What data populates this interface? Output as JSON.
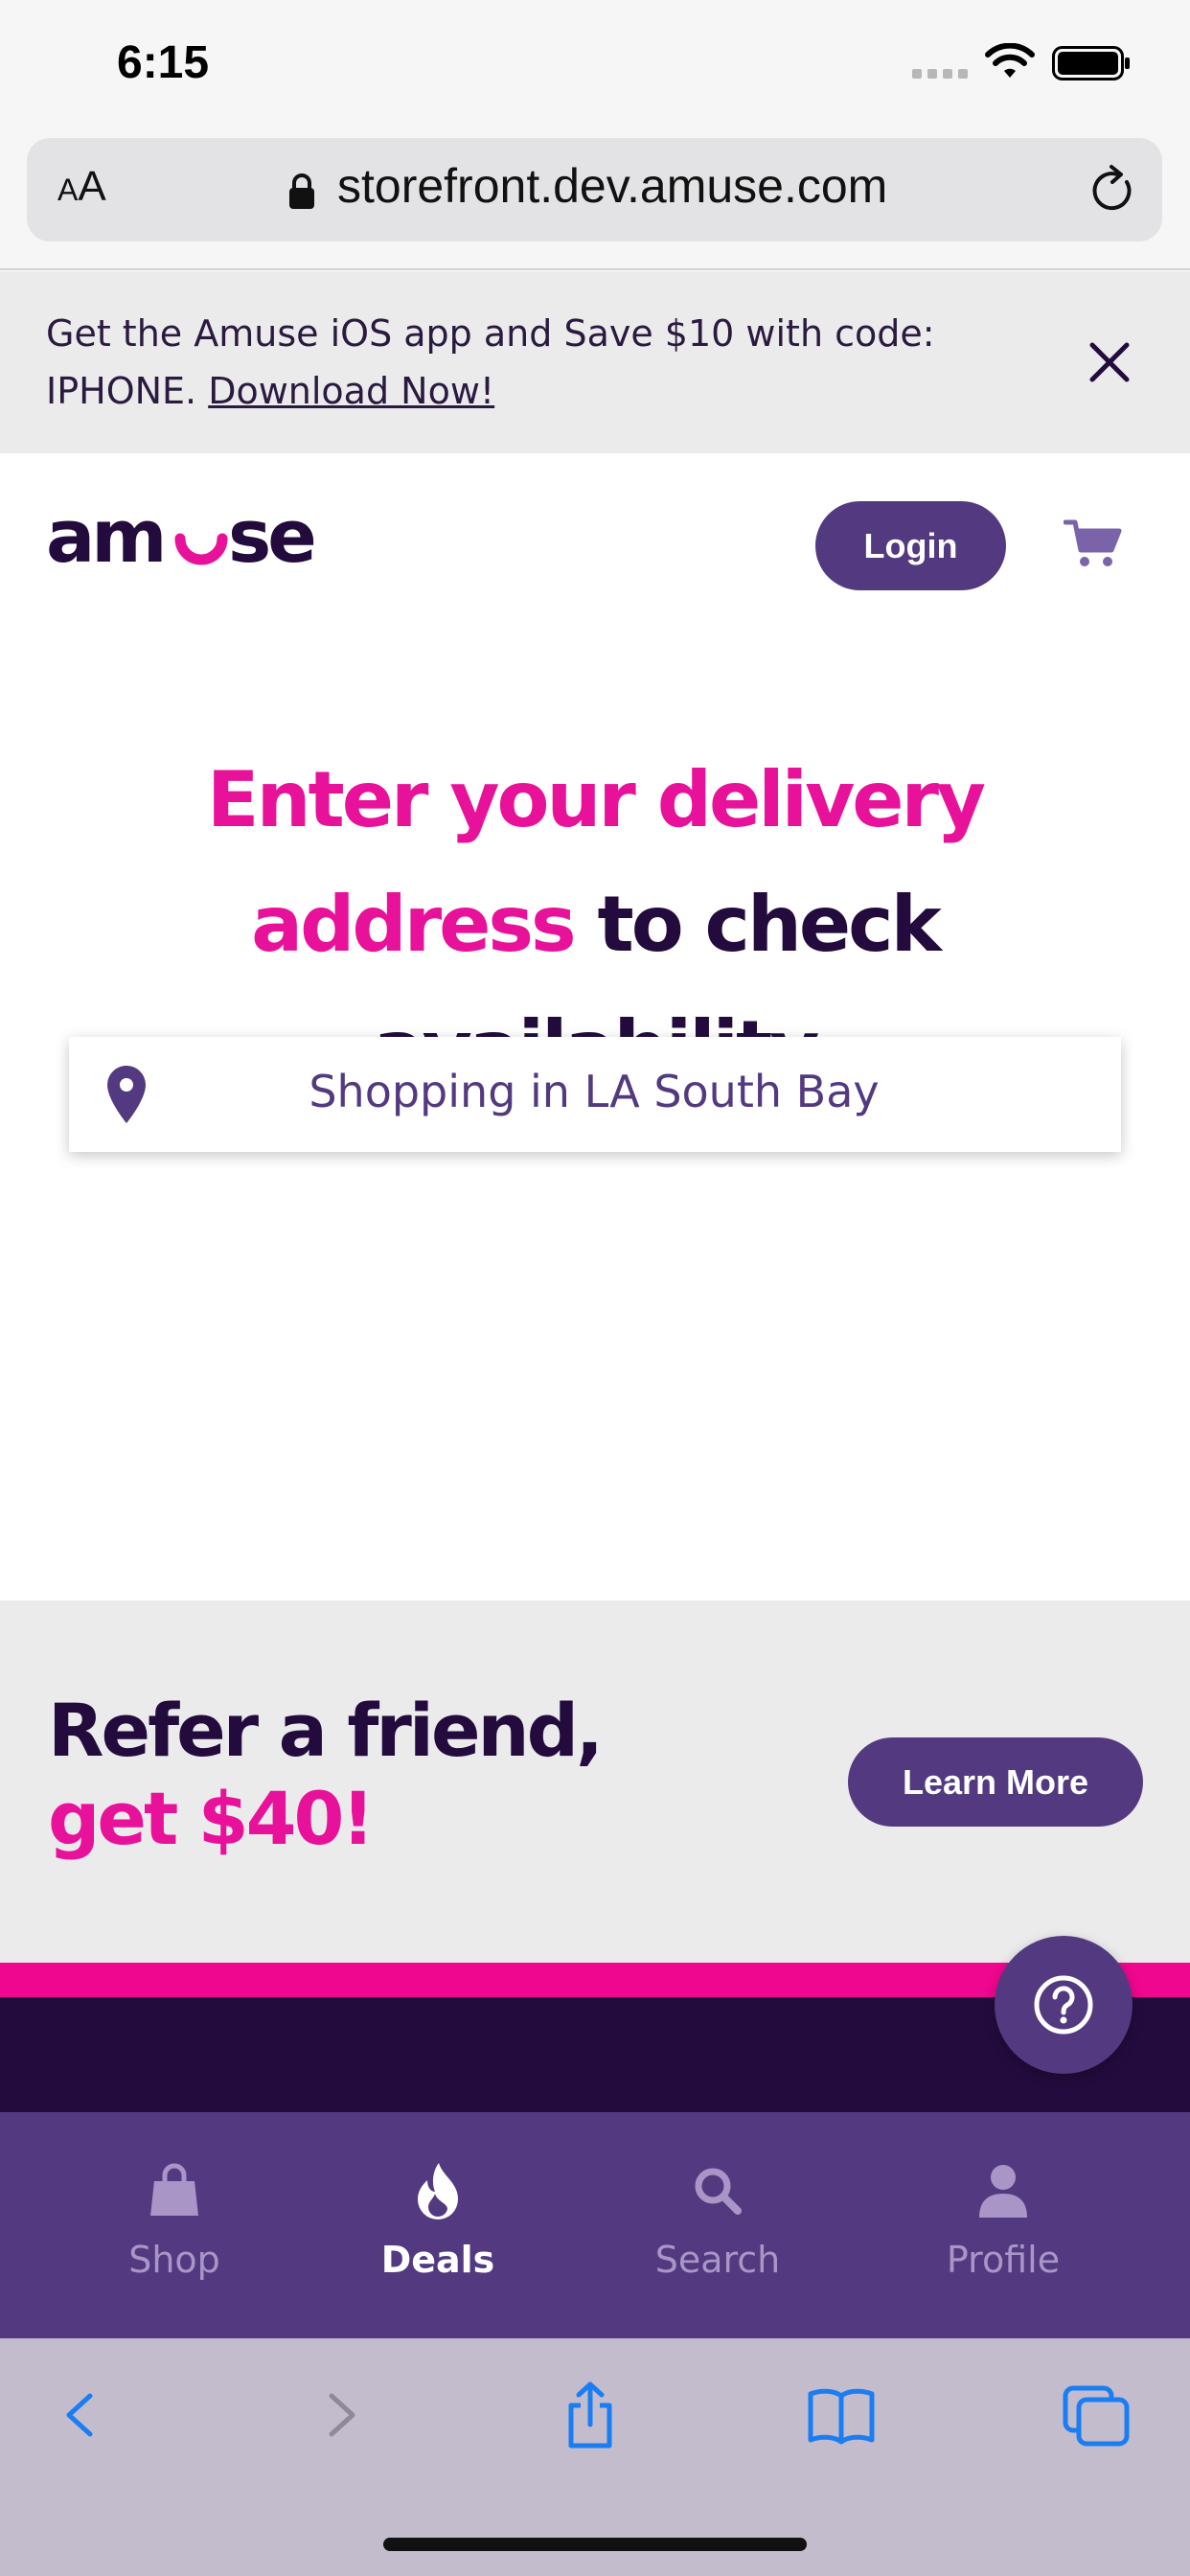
{
  "status_bar": {
    "time": "6:15"
  },
  "browser": {
    "text_size_label": "AA",
    "url": "storefront.dev.amuse.com"
  },
  "app_banner": {
    "text": "Get the Amuse iOS app and Save $10 with code: IPHONE. ",
    "link_label": "Download Now!"
  },
  "header": {
    "logo": "amuse",
    "login_label": "Login"
  },
  "hero": {
    "title_highlight": "Enter your delivery address",
    "title_rest": " to check availability"
  },
  "location": {
    "text": "Shopping in LA South Bay"
  },
  "refer": {
    "line1": "Refer a friend,",
    "line2": "get $40!",
    "button_label": "Learn More"
  },
  "bottom_nav": {
    "items": [
      {
        "label": "Shop",
        "icon": "bag-icon",
        "active": false
      },
      {
        "label": "Deals",
        "icon": "flame-icon",
        "active": true
      },
      {
        "label": "Search",
        "icon": "search-icon",
        "active": false
      },
      {
        "label": "Profile",
        "icon": "person-icon",
        "active": false
      }
    ]
  },
  "colors": {
    "brand_purple": "#533a80",
    "brand_pink": "#e8119a",
    "dark": "#230c3d",
    "safari_blue": "#1a7ef2"
  }
}
